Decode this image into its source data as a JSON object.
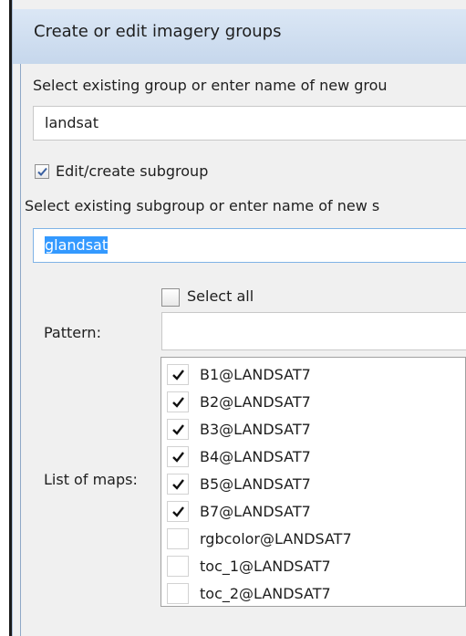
{
  "window": {
    "title": "Create or edit imagery groups"
  },
  "group": {
    "label": "Select existing group or enter name of new grou",
    "value": "landsat"
  },
  "subgroup": {
    "checkbox_label": "Edit/create subgroup",
    "checkbox_checked": true,
    "label": "Select existing subgroup or enter name of new s",
    "value": "glandsat"
  },
  "select_all": {
    "label": "Select all",
    "checked": false
  },
  "pattern": {
    "label": "Pattern:",
    "value": ""
  },
  "maps": {
    "label": "List of maps:",
    "items": [
      {
        "name": "B1@LANDSAT7",
        "checked": true
      },
      {
        "name": "B2@LANDSAT7",
        "checked": true
      },
      {
        "name": "B3@LANDSAT7",
        "checked": true
      },
      {
        "name": "B4@LANDSAT7",
        "checked": true
      },
      {
        "name": "B5@LANDSAT7",
        "checked": true
      },
      {
        "name": "B7@LANDSAT7",
        "checked": true
      },
      {
        "name": "rgbcolor@LANDSAT7",
        "checked": false
      },
      {
        "name": "toc_1@LANDSAT7",
        "checked": false
      },
      {
        "name": "toc_2@LANDSAT7",
        "checked": false
      }
    ]
  },
  "icons": {
    "check": "check-mark-icon"
  }
}
